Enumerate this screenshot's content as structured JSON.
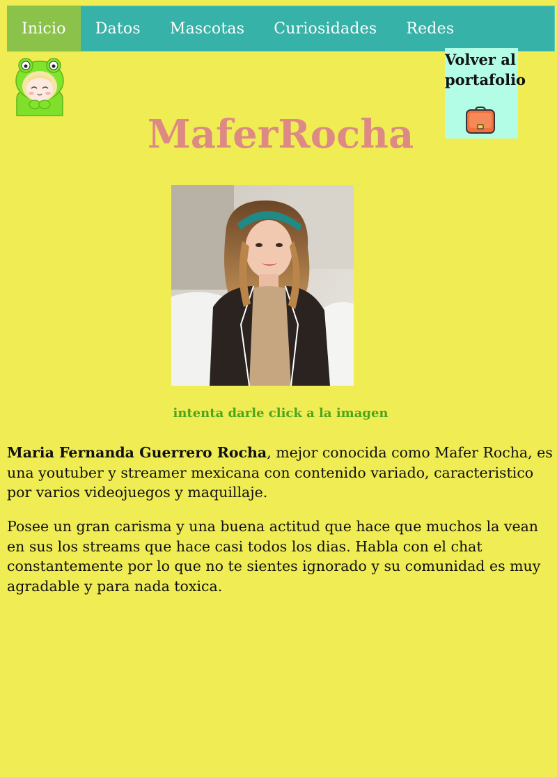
{
  "nav": {
    "items": [
      {
        "label": "Inicio",
        "active": true
      },
      {
        "label": "Datos"
      },
      {
        "label": "Mascotas"
      },
      {
        "label": "Curiosidades"
      },
      {
        "label": "Redes"
      }
    ]
  },
  "portfolio": {
    "label": "Volver al portafolio",
    "icon": "briefcase-icon"
  },
  "header": {
    "title": "MaferRocha",
    "avatar_icon": "frog-hood-avatar-icon"
  },
  "photo": {
    "alt": "Foto de Mafer Rocha"
  },
  "hint": "intenta darle click a la imagen",
  "bio": {
    "p1_name": "Maria Fernanda Guerrero Rocha",
    "p1_rest": ", mejor conocida como Mafer Rocha, es una youtuber y streamer mexicana con contenido variado, caracteristico por varios videojuegos y maquillaje.",
    "p2": "Posee un gran carisma y una buena actitud que hace que muchos la vean en sus los streams que hace casi todos los dias. Habla con el chat constantemente por lo que no te sientes ignorado y su comunidad es muy agradable y para nada toxica."
  },
  "colors": {
    "background": "#f0ed54",
    "nav": "#36b2a8",
    "nav_active": "#8bc34a",
    "title": "#de8a84",
    "hint": "#4ca51e",
    "portfolio_box": "#b3fde6"
  }
}
